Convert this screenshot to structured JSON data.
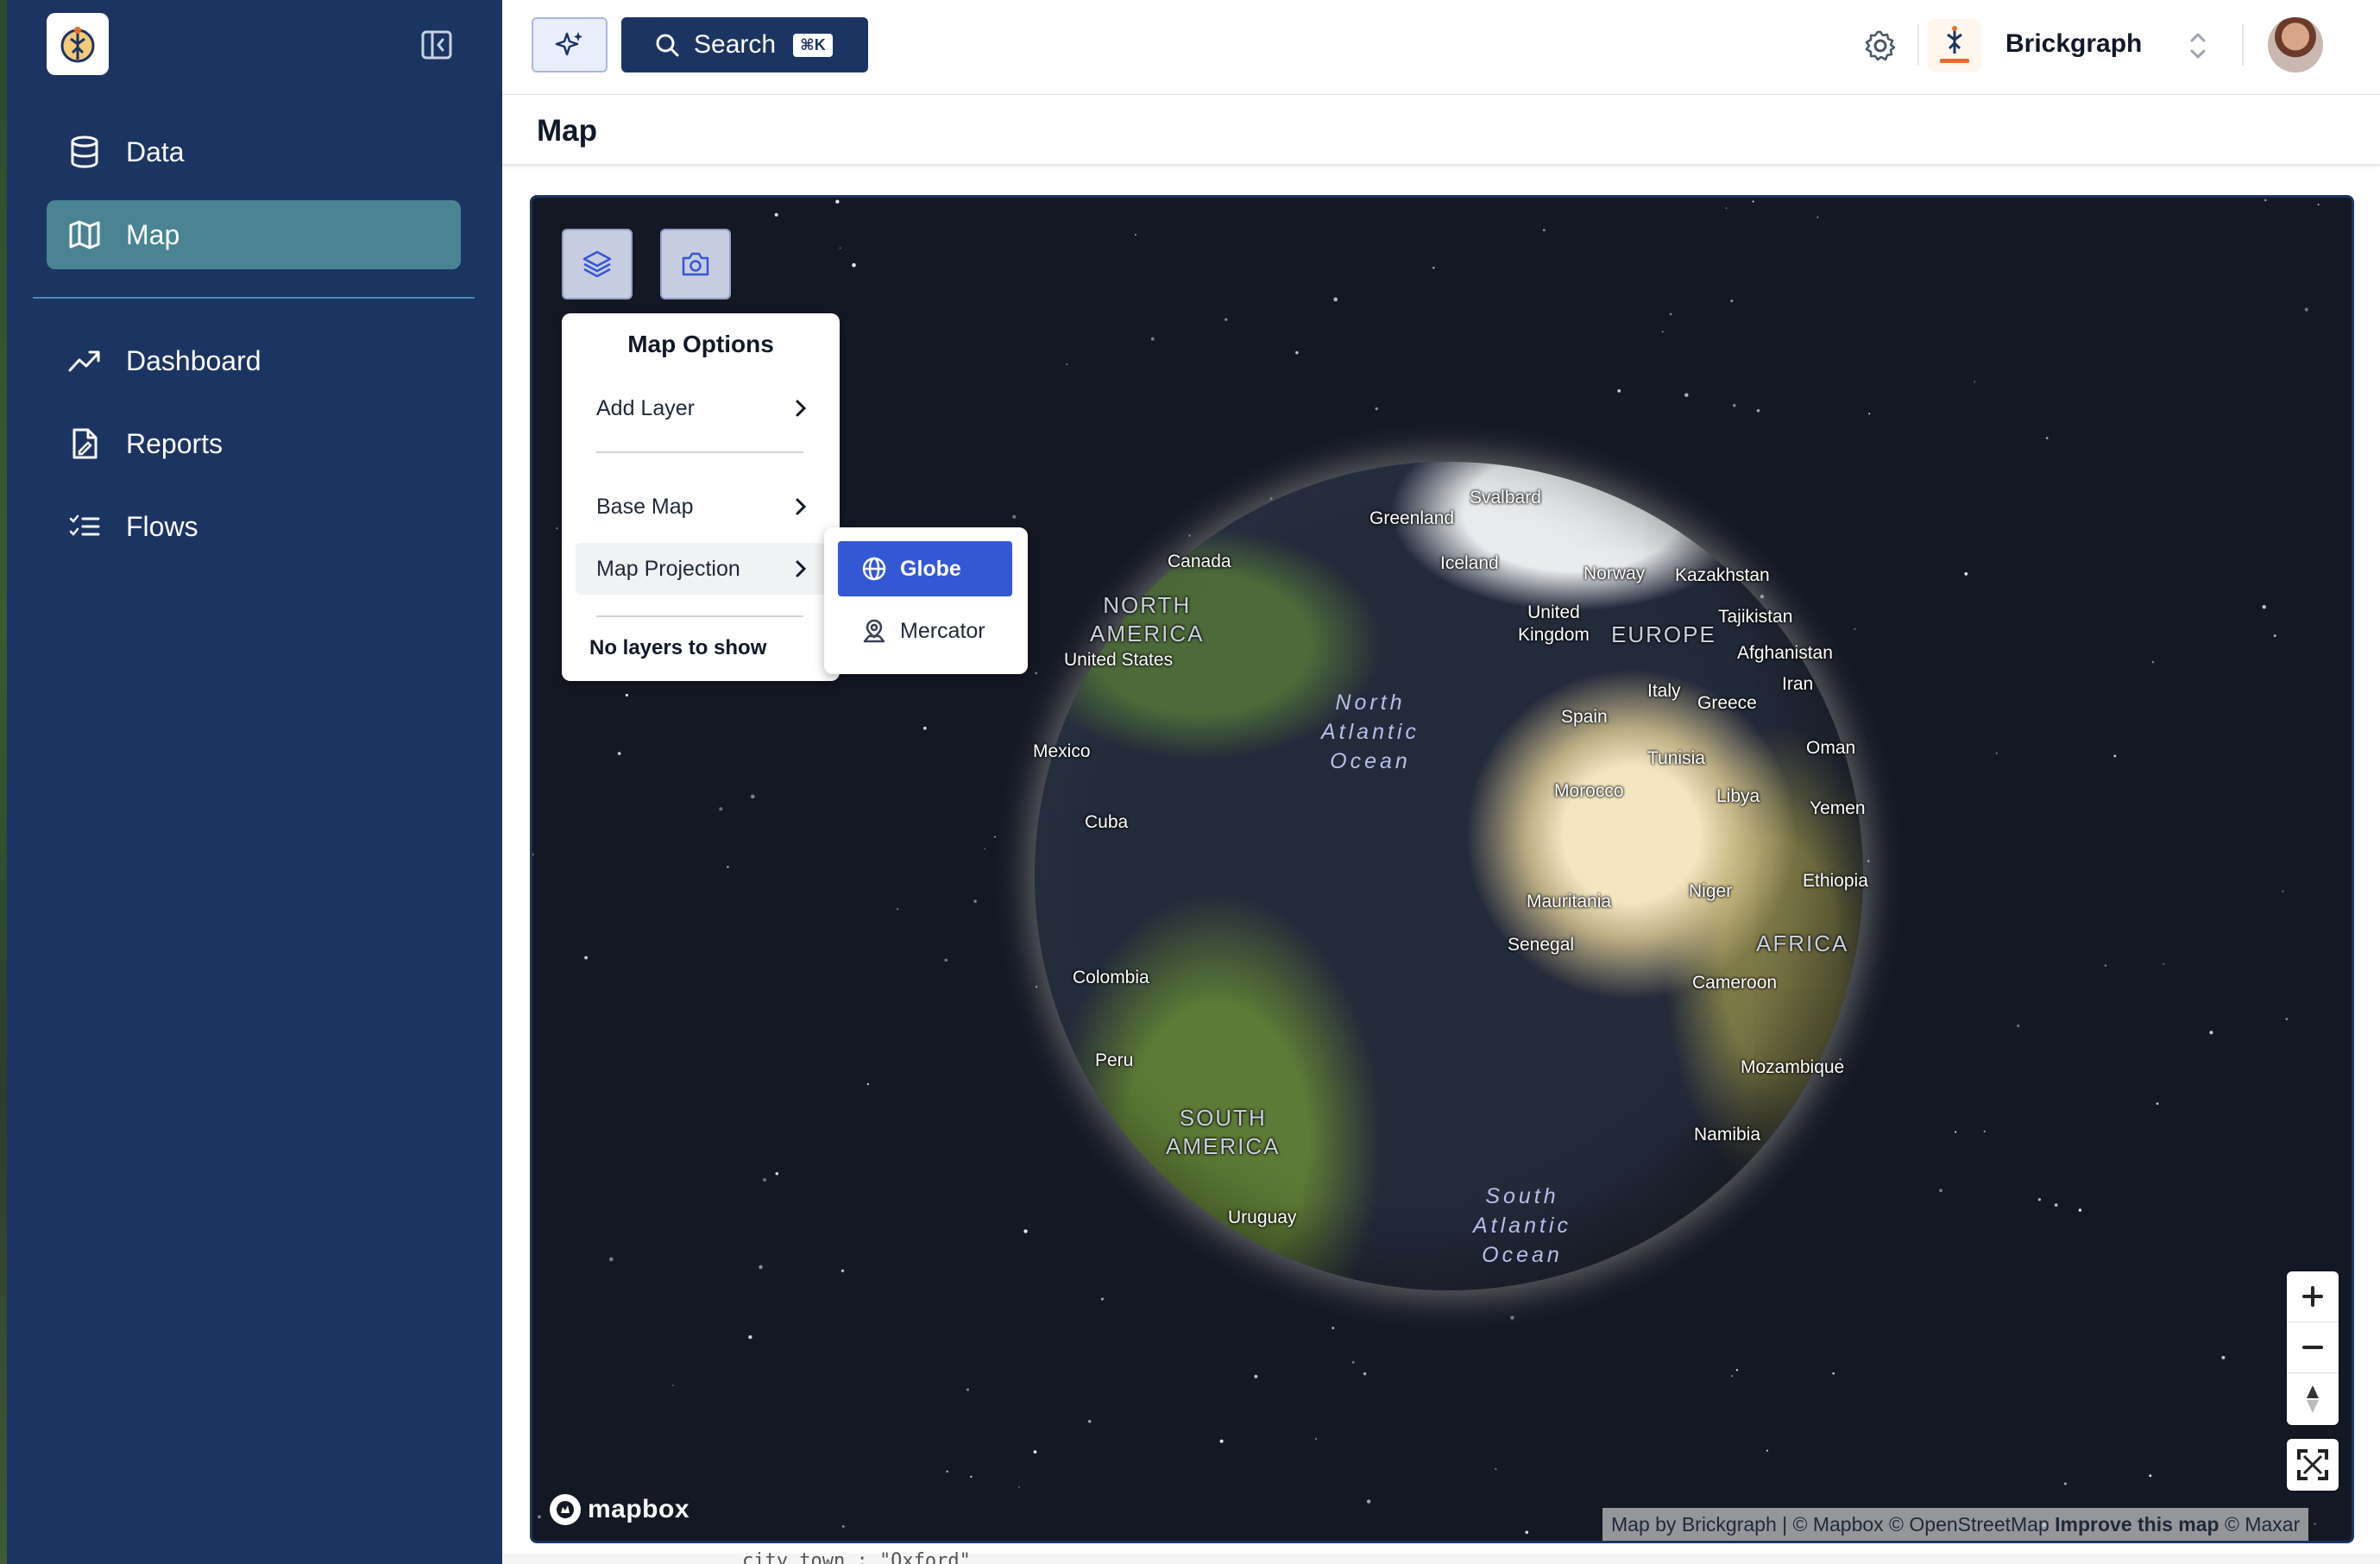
{
  "sidebar": {
    "items": [
      {
        "label": "Data",
        "icon": "database-icon"
      },
      {
        "label": "Map",
        "icon": "map-icon",
        "active": true
      },
      {
        "label": "Dashboard",
        "icon": "trending-up-icon"
      },
      {
        "label": "Reports",
        "icon": "report-file-icon"
      },
      {
        "label": "Flows",
        "icon": "list-checks-icon"
      }
    ]
  },
  "topbar": {
    "search_label": "Search",
    "search_shortcut": "⌘K",
    "org_name": "Brickgraph"
  },
  "page": {
    "title": "Map"
  },
  "map": {
    "labels": {
      "svalbard": "Svalbard",
      "greenland": "Greenland",
      "canada": "Canada",
      "iceland": "Iceland",
      "norway": "Norway",
      "kazakhstan": "Kazakhstan",
      "north_america": "NORTH\nAMERICA",
      "united_kingdom": "United\nKingdom",
      "europe": "EUROPE",
      "tajikistan": "Tajikistan",
      "afghanistan": "Afghanistan",
      "united_states": "United States",
      "iran": "Iran",
      "italy": "Italy",
      "greece": "Greece",
      "north_atlantic": "North\nAtlantic\nOcean",
      "spain": "Spain",
      "mexico": "Mexico",
      "oman": "Oman",
      "tunisia": "Tunisia",
      "morocco": "Morocco",
      "libya": "Libya",
      "yemen": "Yemen",
      "cuba": "Cuba",
      "ethiopia": "Ethiopia",
      "niger": "Niger",
      "mauritania": "Mauritania",
      "senegal": "Senegal",
      "africa": "AFRICA",
      "colombia": "Colombia",
      "cameroon": "Cameroon",
      "peru": "Peru",
      "mozambique": "Mozambique",
      "south_america": "SOUTH\nAMERICA",
      "namibia": "Namibia",
      "uruguay": "Uruguay",
      "south_atlantic": "South\nAtlantic\nOcean"
    },
    "options": {
      "title": "Map Options",
      "add_layer": "Add Layer",
      "base_map": "Base Map",
      "map_projection": "Map Projection",
      "empty_text": "No layers to show"
    },
    "projection": {
      "selected": "Globe",
      "options": [
        "Globe",
        "Mercator"
      ]
    },
    "controls": {
      "zoom_in": "+",
      "zoom_out": "−"
    },
    "brand": "mapbox",
    "attribution": {
      "text": "Map by Brickgraph | © Mapbox © OpenStreetMap",
      "improve": "Improve this map",
      "maxar": "© Maxar"
    }
  },
  "colors": {
    "sidebar_bg": "#1b3462",
    "active_nav": "#4a8492",
    "selected_projection": "#3457d5",
    "map_bg": "#141824"
  },
  "footer_snippet": "city_town : \"Oxford\""
}
